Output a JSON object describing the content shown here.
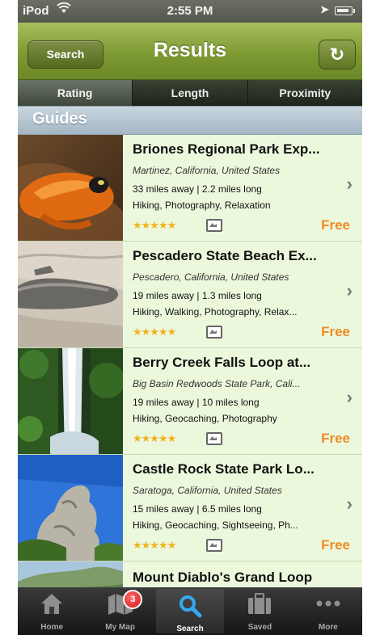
{
  "status_bar": {
    "carrier": "iPod",
    "time": "2:55 PM"
  },
  "nav": {
    "title": "Results",
    "back_label": "Search"
  },
  "sort_tabs": [
    "Rating",
    "Length",
    "Proximity"
  ],
  "section": {
    "title": "Guides"
  },
  "results": [
    {
      "title": "Briones Regional Park Exp...",
      "location": "Martinez, California, United States",
      "stats": "33 miles away  |  2.2 miles long",
      "tags": "Hiking, Photography, Relaxation",
      "stars": "★★★★★",
      "price": "Free",
      "thumbnail": "orange-salamander-photo"
    },
    {
      "title": "Pescadero State Beach Ex...",
      "location": "Pescadero, California, United States",
      "stats": "19 miles away  |  1.3 miles long",
      "tags": "Hiking, Walking, Photography, Relax...",
      "stars": "★★★★★",
      "price": "Free",
      "thumbnail": "driftwood-beach-photo"
    },
    {
      "title": "Berry Creek Falls Loop at...",
      "location": "Big Basin Redwoods State Park, Cali...",
      "stats": "19 miles away  |  10 miles long",
      "tags": "Hiking, Geocaching, Photography",
      "stars": "★★★★★",
      "price": "Free",
      "thumbnail": "waterfall-photo"
    },
    {
      "title": "Castle Rock State Park Lo...",
      "location": "Saratoga, California, United States",
      "stats": "15 miles away  |  6.5 miles long",
      "tags": "Hiking, Geocaching, Sightseeing, Ph...",
      "stars": "★★★★★",
      "price": "Free",
      "thumbnail": "rock-formation-photo"
    },
    {
      "title": "Mount Diablo's Grand Loop",
      "thumbnail": "mountain-valley-photo"
    }
  ],
  "tab_bar": [
    {
      "label": "Home",
      "icon": "house-icon"
    },
    {
      "label": "My Map",
      "icon": "map-icon",
      "badge": "3"
    },
    {
      "label": "Search",
      "icon": "magnifier-icon",
      "active": true
    },
    {
      "label": "Saved",
      "icon": "briefcase-icon"
    },
    {
      "label": "More",
      "icon": "more-dots-icon"
    }
  ],
  "colors": {
    "price": "#f08a24",
    "stars": "#f1b21e",
    "row_bg": "#ecf8dc",
    "nav": "#7e9a33"
  }
}
